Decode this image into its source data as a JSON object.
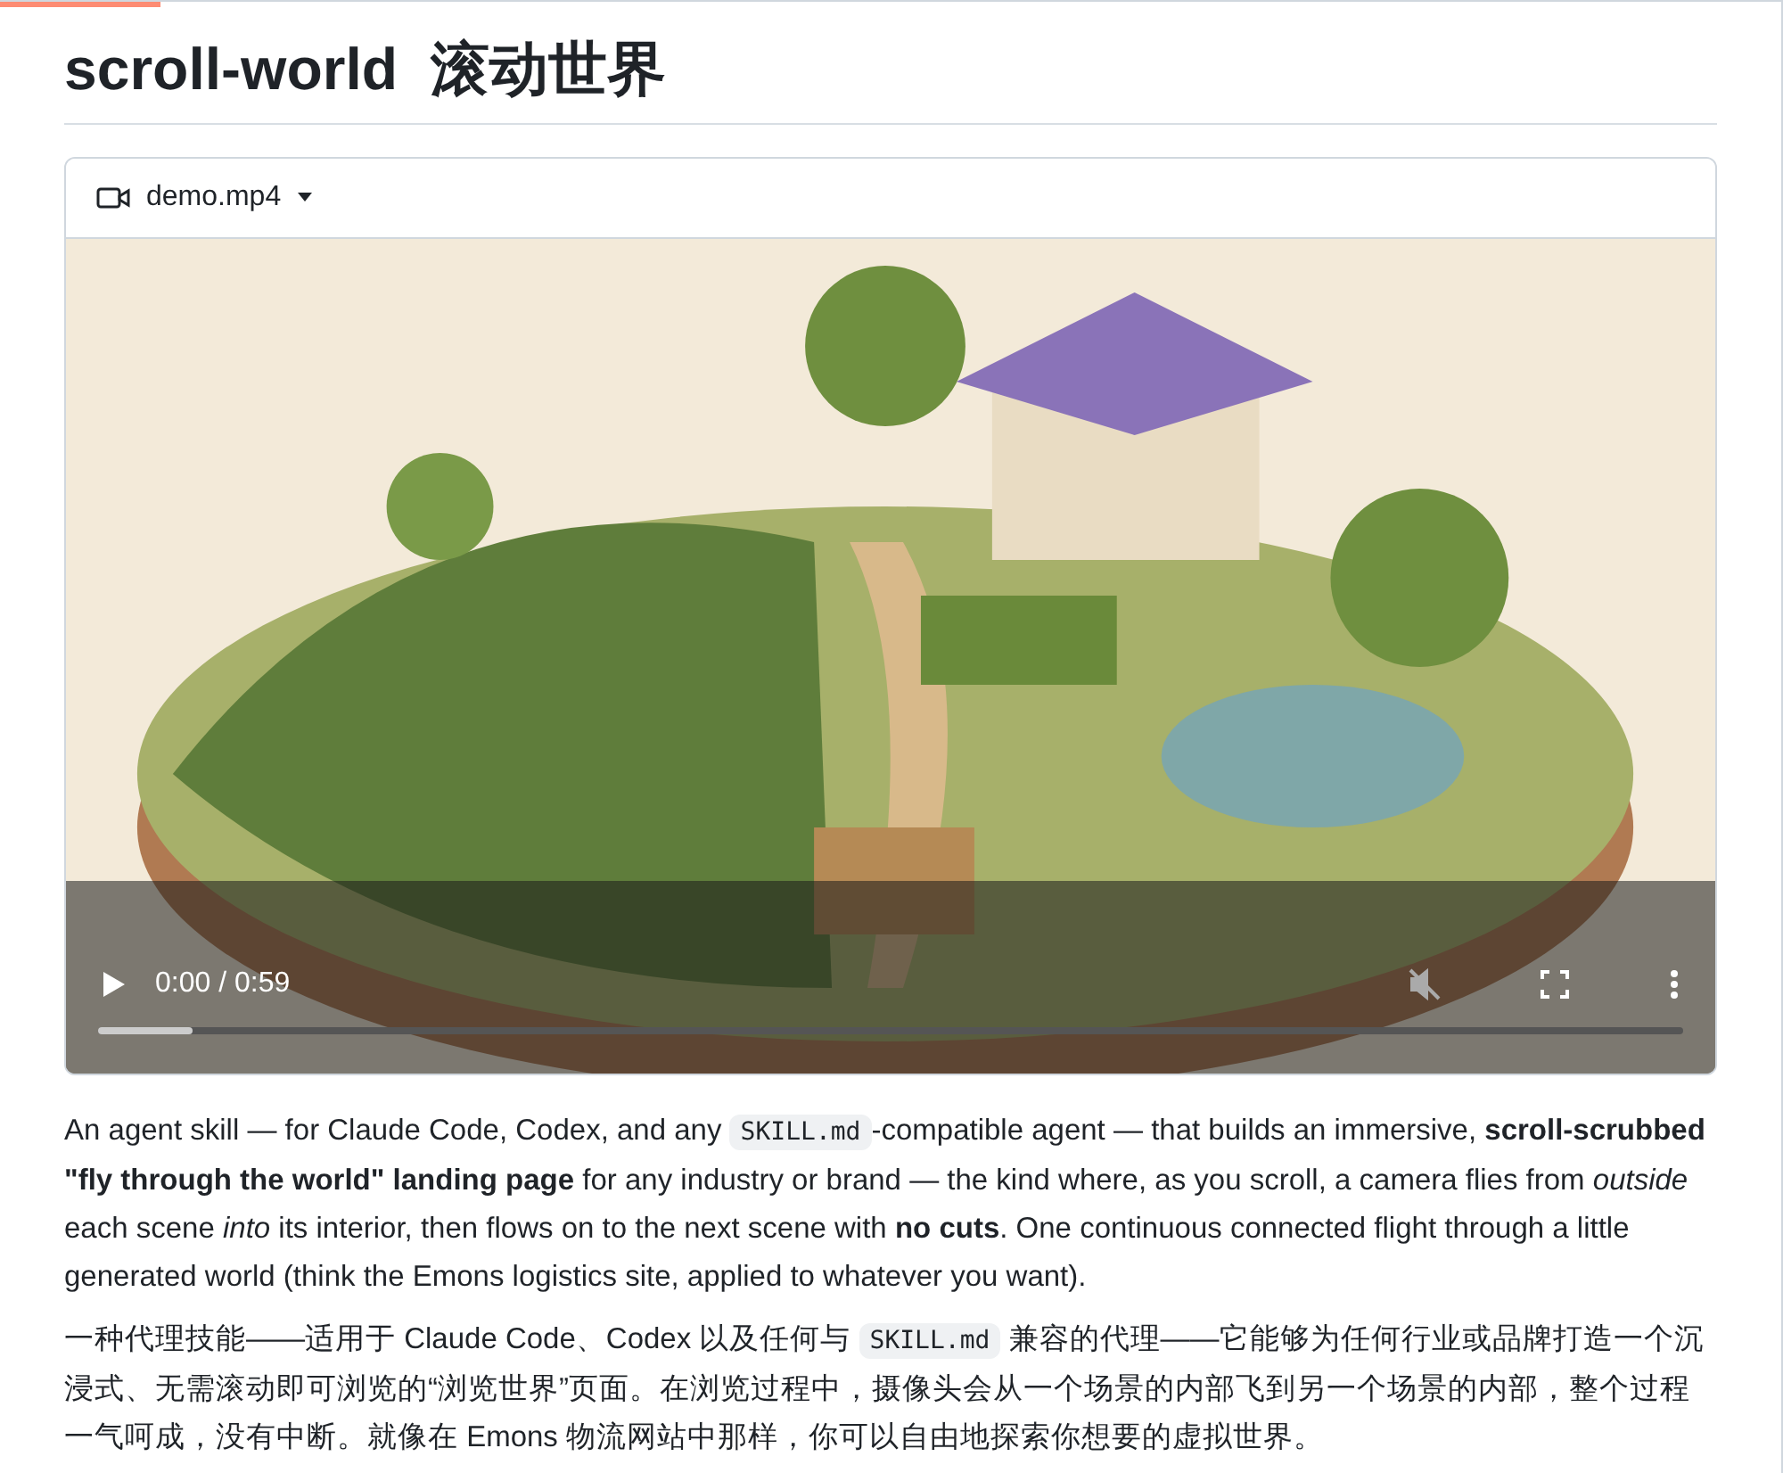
{
  "title": "scroll-world  滚动世界",
  "video": {
    "file_name": "demo.mp4",
    "time": "0:00 / 0:59",
    "muted": true,
    "level": 0.06
  },
  "paragraphs": [
    {
      "segments": [
        {
          "kind": "text",
          "text": "An agent skill — for Claude Code, Codex, and any "
        },
        {
          "kind": "code",
          "text": "SKILL.md"
        },
        {
          "kind": "text",
          "text": "-compatible agent — that builds an immersive, **scroll-scrubbed \"fly through the world\" landing page** for any industry or brand — the kind where, as you scroll, a camera flies from *outside* each scene *into* its interior, then flows on to the next scene with **no cuts**. One continuous connected flight through a little generated world (think the Emons logistics site, applied to whatever you want)."
        }
      ]
    },
    {
      "segments": [
        {
          "kind": "text",
          "text": "一种代理技能——适用于 Claude Code、Codex 以及任何与 "
        },
        {
          "kind": "code",
          "text": "SKILL.md"
        },
        {
          "kind": "text",
          "text": " 兼容的代理——它能够为任何行业或品牌打造一个沉浸式、无需滚动即可浏览的“浏览世界”页面。在浏览过程中，摄像头会从一个场景的内部飞到另一个场景的内部，整个过程一气呵成，没有中断。就像在 Emons 物流网站中那样，你可以自由地探索你想要的虚拟世界。"
        }
      ]
    }
  ]
}
